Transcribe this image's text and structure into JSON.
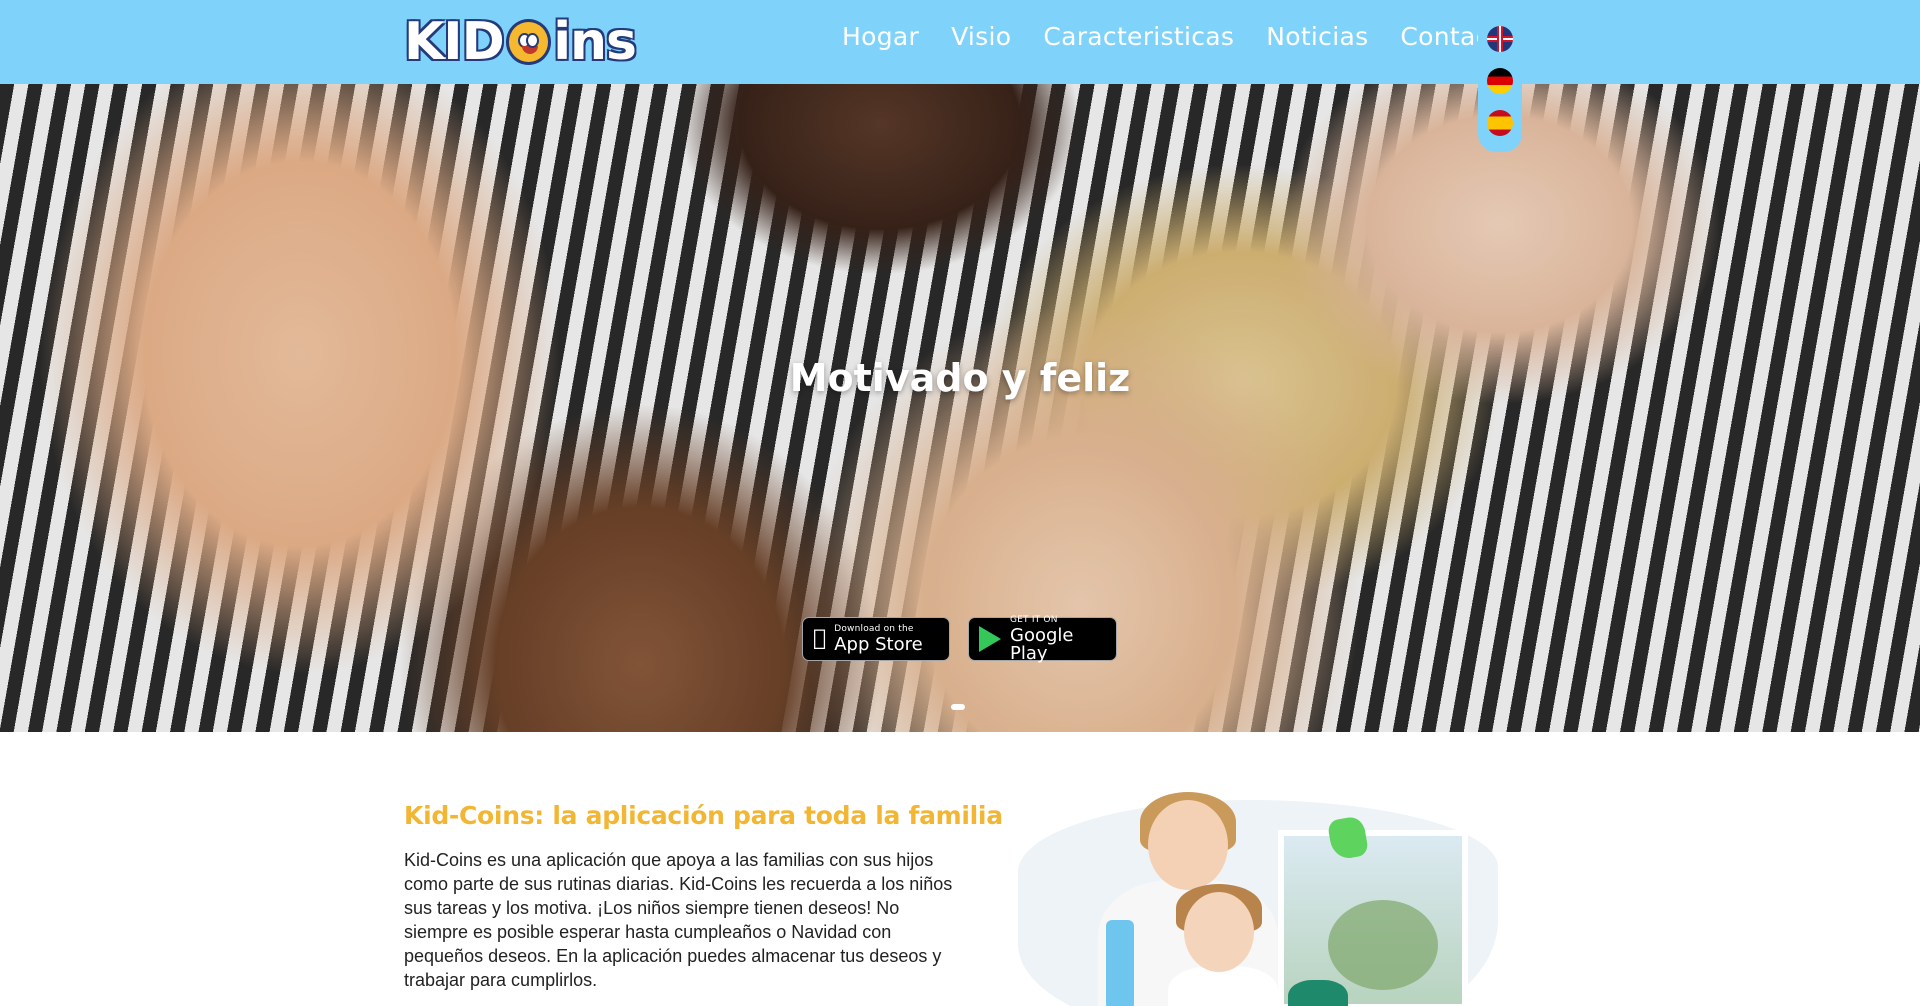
{
  "header": {
    "logo_text_left": "KID",
    "logo_text_right": "ins",
    "nav": [
      {
        "label": "Hogar"
      },
      {
        "label": "Visio"
      },
      {
        "label": "Caracteristicas"
      },
      {
        "label": "Noticias"
      },
      {
        "label": "Contacto"
      }
    ],
    "languages": [
      {
        "icon": "flag-uk-icon"
      },
      {
        "icon": "flag-de-icon"
      },
      {
        "icon": "flag-es-icon"
      }
    ]
  },
  "hero": {
    "title": "Motivado y feliz",
    "app_store": {
      "small": "Download on the",
      "big": "App Store",
      "icon": "apple-icon"
    },
    "google_play": {
      "small": "GET IT ON",
      "big": "Google Play",
      "icon": "google-play-icon"
    }
  },
  "content": {
    "title": "Kid-Coins: la aplicación para toda la familia",
    "body": "Kid-Coins es una aplicación que apoya a las familias con sus hijos como parte de sus rutinas diarias. Kid-Coins les recuerda a los niños sus tareas y los motiva. ¡Los niños siempre tienen deseos! No siempre es posible esperar hasta cumpleaños o Navidad con pequeños deseos. En la aplicación puedes almacenar tus deseos y trabajar para cumplirlos."
  },
  "colors": {
    "header_bg": "#7fd3fb",
    "title_accent": "#f2b633"
  }
}
